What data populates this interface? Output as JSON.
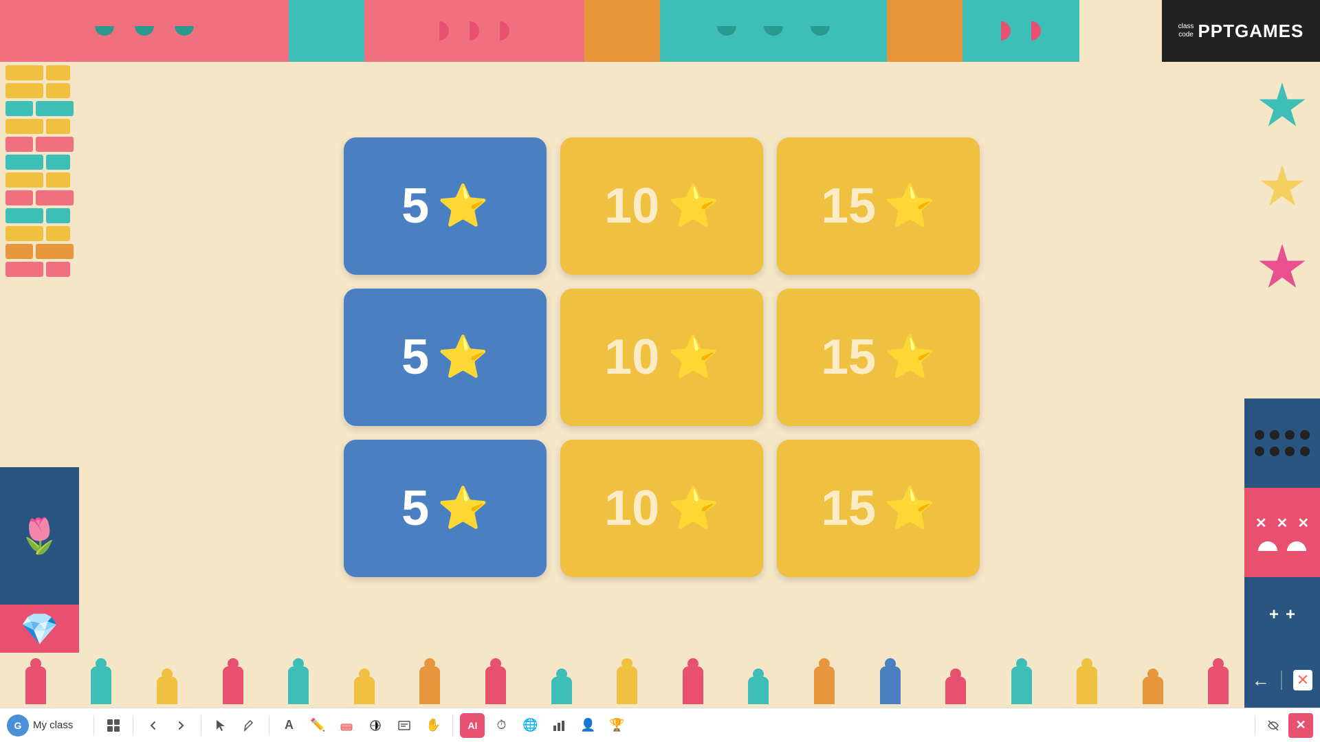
{
  "logo": {
    "appname": "PPTGAMES",
    "badge": "class\ncode"
  },
  "cards": [
    {
      "value": "5",
      "type": "blue"
    },
    {
      "value": "10",
      "type": "yellow"
    },
    {
      "value": "15",
      "type": "yellow"
    },
    {
      "value": "5",
      "type": "blue"
    },
    {
      "value": "10",
      "type": "yellow"
    },
    {
      "value": "15",
      "type": "yellow"
    },
    {
      "value": "5",
      "type": "blue"
    },
    {
      "value": "10",
      "type": "yellow"
    },
    {
      "value": "15",
      "type": "yellow"
    }
  ],
  "toolbar": {
    "myclass_label": "My class"
  },
  "colors": {
    "blue_card": "#4a7fc1",
    "yellow_card": "#f0c040",
    "teal": "#3dbfb8",
    "pink": "#f07080",
    "orange": "#e8963c"
  }
}
